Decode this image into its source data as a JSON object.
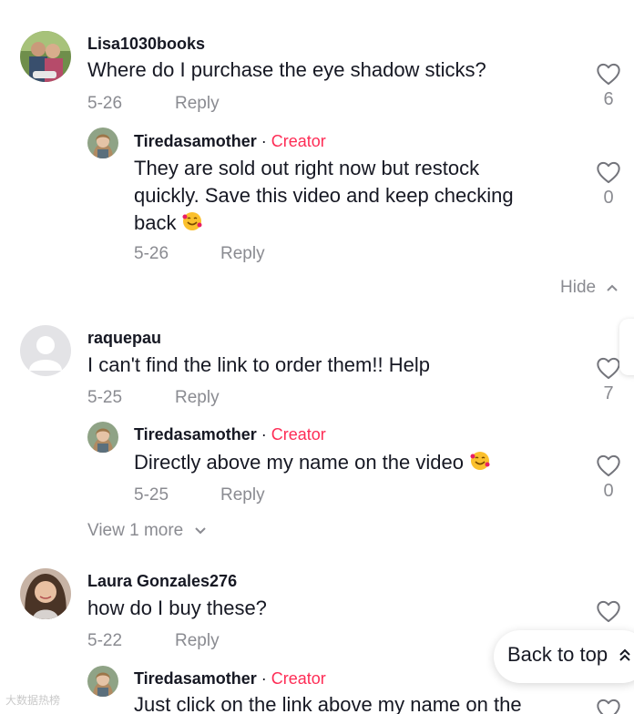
{
  "comments": [
    {
      "username": "Lisa1030books",
      "text": "Where do I purchase the eye shadow sticks?",
      "date": "5-26",
      "reply_label": "Reply",
      "likes": "6",
      "replies": [
        {
          "username": "Tiredasamother",
          "separator": "·",
          "badge": "Creator",
          "text_lines": [
            "They are sold out right now but restock",
            "quickly. Save this video and keep checking",
            "back"
          ],
          "date": "5-26",
          "reply_label": "Reply",
          "likes": "0"
        }
      ],
      "hide_label": "Hide"
    },
    {
      "username": "raquepau",
      "text": "I can't find the link to order them!! Help",
      "date": "5-25",
      "reply_label": "Reply",
      "likes": "7",
      "replies": [
        {
          "username": "Tiredasamother",
          "separator": "·",
          "badge": "Creator",
          "text": "Directly above my name on the video",
          "date": "5-25",
          "reply_label": "Reply",
          "likes": "0"
        }
      ],
      "view_more_label": "View 1 more"
    },
    {
      "username": "Laura Gonzales276",
      "text": "how do I buy these?",
      "date": "5-22",
      "reply_label": "Reply",
      "replies": [
        {
          "username": "Tiredasamother",
          "separator": "·",
          "badge": "Creator",
          "text": "Just click on the link above my name on the"
        }
      ]
    }
  ],
  "back_to_top_label": "Back to top",
  "watermark": "大数据热榜",
  "colors": {
    "creator": "#fe2c55",
    "muted": "#8a8b91",
    "text": "#161823"
  },
  "icons": [
    "heart-outline-icon",
    "chevron-up-icon",
    "chevron-down-icon",
    "double-chevron-up-icon",
    "smiling-face-with-hearts-emoji"
  ]
}
